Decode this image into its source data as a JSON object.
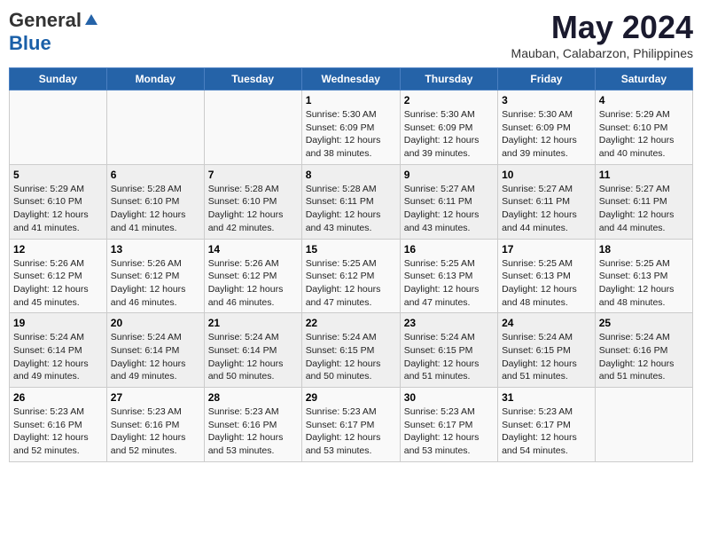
{
  "logo": {
    "general": "General",
    "blue": "Blue"
  },
  "title": "May 2024",
  "subtitle": "Mauban, Calabarzon, Philippines",
  "days_of_week": [
    "Sunday",
    "Monday",
    "Tuesday",
    "Wednesday",
    "Thursday",
    "Friday",
    "Saturday"
  ],
  "weeks": [
    [
      {
        "day": "",
        "info": ""
      },
      {
        "day": "",
        "info": ""
      },
      {
        "day": "",
        "info": ""
      },
      {
        "day": "1",
        "info": "Sunrise: 5:30 AM\nSunset: 6:09 PM\nDaylight: 12 hours\nand 38 minutes."
      },
      {
        "day": "2",
        "info": "Sunrise: 5:30 AM\nSunset: 6:09 PM\nDaylight: 12 hours\nand 39 minutes."
      },
      {
        "day": "3",
        "info": "Sunrise: 5:30 AM\nSunset: 6:09 PM\nDaylight: 12 hours\nand 39 minutes."
      },
      {
        "day": "4",
        "info": "Sunrise: 5:29 AM\nSunset: 6:10 PM\nDaylight: 12 hours\nand 40 minutes."
      }
    ],
    [
      {
        "day": "5",
        "info": "Sunrise: 5:29 AM\nSunset: 6:10 PM\nDaylight: 12 hours\nand 41 minutes."
      },
      {
        "day": "6",
        "info": "Sunrise: 5:28 AM\nSunset: 6:10 PM\nDaylight: 12 hours\nand 41 minutes."
      },
      {
        "day": "7",
        "info": "Sunrise: 5:28 AM\nSunset: 6:10 PM\nDaylight: 12 hours\nand 42 minutes."
      },
      {
        "day": "8",
        "info": "Sunrise: 5:28 AM\nSunset: 6:11 PM\nDaylight: 12 hours\nand 43 minutes."
      },
      {
        "day": "9",
        "info": "Sunrise: 5:27 AM\nSunset: 6:11 PM\nDaylight: 12 hours\nand 43 minutes."
      },
      {
        "day": "10",
        "info": "Sunrise: 5:27 AM\nSunset: 6:11 PM\nDaylight: 12 hours\nand 44 minutes."
      },
      {
        "day": "11",
        "info": "Sunrise: 5:27 AM\nSunset: 6:11 PM\nDaylight: 12 hours\nand 44 minutes."
      }
    ],
    [
      {
        "day": "12",
        "info": "Sunrise: 5:26 AM\nSunset: 6:12 PM\nDaylight: 12 hours\nand 45 minutes."
      },
      {
        "day": "13",
        "info": "Sunrise: 5:26 AM\nSunset: 6:12 PM\nDaylight: 12 hours\nand 46 minutes."
      },
      {
        "day": "14",
        "info": "Sunrise: 5:26 AM\nSunset: 6:12 PM\nDaylight: 12 hours\nand 46 minutes."
      },
      {
        "day": "15",
        "info": "Sunrise: 5:25 AM\nSunset: 6:12 PM\nDaylight: 12 hours\nand 47 minutes."
      },
      {
        "day": "16",
        "info": "Sunrise: 5:25 AM\nSunset: 6:13 PM\nDaylight: 12 hours\nand 47 minutes."
      },
      {
        "day": "17",
        "info": "Sunrise: 5:25 AM\nSunset: 6:13 PM\nDaylight: 12 hours\nand 48 minutes."
      },
      {
        "day": "18",
        "info": "Sunrise: 5:25 AM\nSunset: 6:13 PM\nDaylight: 12 hours\nand 48 minutes."
      }
    ],
    [
      {
        "day": "19",
        "info": "Sunrise: 5:24 AM\nSunset: 6:14 PM\nDaylight: 12 hours\nand 49 minutes."
      },
      {
        "day": "20",
        "info": "Sunrise: 5:24 AM\nSunset: 6:14 PM\nDaylight: 12 hours\nand 49 minutes."
      },
      {
        "day": "21",
        "info": "Sunrise: 5:24 AM\nSunset: 6:14 PM\nDaylight: 12 hours\nand 50 minutes."
      },
      {
        "day": "22",
        "info": "Sunrise: 5:24 AM\nSunset: 6:15 PM\nDaylight: 12 hours\nand 50 minutes."
      },
      {
        "day": "23",
        "info": "Sunrise: 5:24 AM\nSunset: 6:15 PM\nDaylight: 12 hours\nand 51 minutes."
      },
      {
        "day": "24",
        "info": "Sunrise: 5:24 AM\nSunset: 6:15 PM\nDaylight: 12 hours\nand 51 minutes."
      },
      {
        "day": "25",
        "info": "Sunrise: 5:24 AM\nSunset: 6:16 PM\nDaylight: 12 hours\nand 51 minutes."
      }
    ],
    [
      {
        "day": "26",
        "info": "Sunrise: 5:23 AM\nSunset: 6:16 PM\nDaylight: 12 hours\nand 52 minutes."
      },
      {
        "day": "27",
        "info": "Sunrise: 5:23 AM\nSunset: 6:16 PM\nDaylight: 12 hours\nand 52 minutes."
      },
      {
        "day": "28",
        "info": "Sunrise: 5:23 AM\nSunset: 6:16 PM\nDaylight: 12 hours\nand 53 minutes."
      },
      {
        "day": "29",
        "info": "Sunrise: 5:23 AM\nSunset: 6:17 PM\nDaylight: 12 hours\nand 53 minutes."
      },
      {
        "day": "30",
        "info": "Sunrise: 5:23 AM\nSunset: 6:17 PM\nDaylight: 12 hours\nand 53 minutes."
      },
      {
        "day": "31",
        "info": "Sunrise: 5:23 AM\nSunset: 6:17 PM\nDaylight: 12 hours\nand 54 minutes."
      },
      {
        "day": "",
        "info": ""
      }
    ]
  ]
}
